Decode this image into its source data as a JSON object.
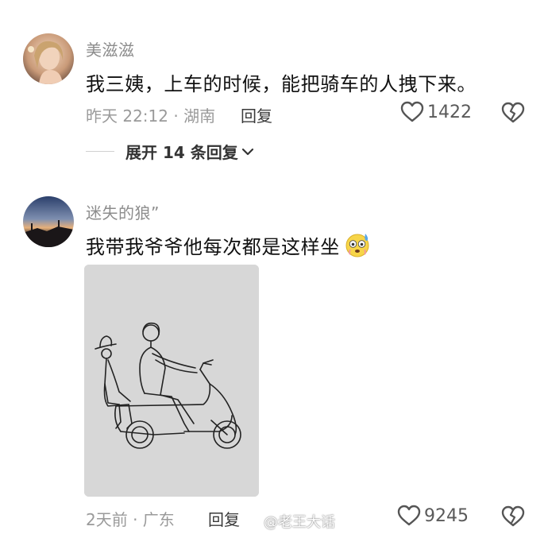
{
  "comments": [
    {
      "username": "美滋滋",
      "text": "我三姨，上车的时候，能把骑车的人拽下来。",
      "time_location": "昨天 22:12 · 湖南",
      "reply_label": "回复",
      "likes": "1422",
      "expand_label": "展开 14 条回复"
    },
    {
      "username": "迷失的狼”",
      "text": "我带我爷爷他每次都是这样坐",
      "time_location": "2天前 · 广东",
      "reply_label": "回复",
      "likes": "9245"
    }
  ],
  "watermark": {
    "text": "@老王大话"
  },
  "icons": {
    "like": "heart-outline-icon",
    "dislike": "broken-heart-icon",
    "expand": "chevron-down-icon",
    "emoji": "flushed-sweat-emoji-icon"
  },
  "colors": {
    "username": "#8c8c8c",
    "meta": "#9a9a9a",
    "text": "#111111",
    "drawing_bg": "#d7d7d7"
  }
}
